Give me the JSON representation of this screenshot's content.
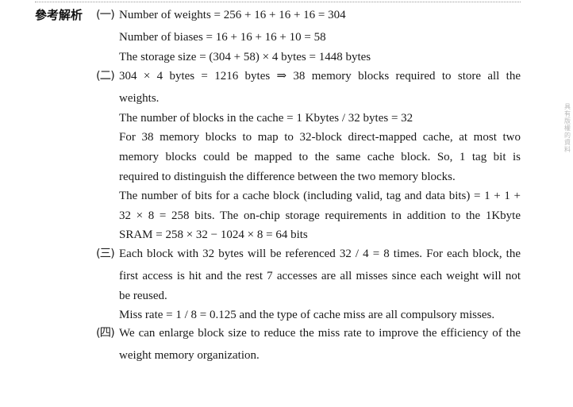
{
  "side_mark": "具有版權的資料",
  "heading": "參考解析",
  "items": [
    {
      "marker": "(一)",
      "lines": [
        "Number of weights = 256 + 16 + 16 + 16 = 304",
        "Number of biases = 16 + 16 + 16 + 10 = 58",
        "The storage size = (304 + 58) × 4 bytes = 1448 bytes"
      ]
    },
    {
      "marker": "(二)",
      "lines": [
        "304 × 4 bytes = 1216 bytes ⇒ 38 memory blocks required to store all the",
        "weights.",
        "The number of blocks in the cache = 1 Kbytes / 32 bytes = 32",
        "For 38 memory blocks to map to 32-block direct-mapped cache, at most two",
        "memory blocks could be mapped to the same cache block. So, 1 tag bit is",
        "required to distinguish the difference between the two memory blocks.",
        "The number of bits for a cache block (including valid, tag and data bits) = 1 + 1 +",
        "32 × 8 = 258 bits. The on-chip storage requirements in addition to the 1Kbyte",
        "SRAM = 258 × 32 − 1024 × 8 = 64 bits"
      ]
    },
    {
      "marker": "(三)",
      "lines": [
        "Each block with 32 bytes will be referenced 32 / 4 = 8 times. For each block, the",
        "first access is hit and the rest 7 accesses are all misses since each weight will not",
        "be reused.",
        "Miss rate = 1 / 8 = 0.125 and the type of cache miss are all compulsory misses."
      ]
    },
    {
      "marker": "(四)",
      "lines": [
        "We can enlarge block size to reduce the miss rate to improve the efficiency of the",
        "weight memory organization."
      ]
    }
  ]
}
